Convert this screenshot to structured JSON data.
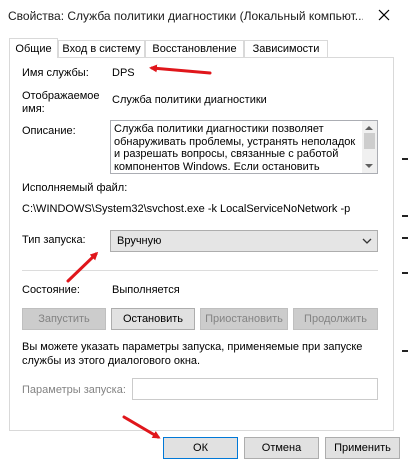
{
  "window": {
    "title": "Свойства: Служба политики диагностики (Локальный компьют..."
  },
  "tabs": [
    {
      "label": "Общие",
      "active": true
    },
    {
      "label": "Вход в систему",
      "active": false
    },
    {
      "label": "Восстановление",
      "active": false
    },
    {
      "label": "Зависимости",
      "active": false
    }
  ],
  "general": {
    "service_name_label": "Имя службы:",
    "service_name": "DPS",
    "display_name_label_line1": "Отображаемое",
    "display_name_label_line2": "имя:",
    "display_name": "Служба политики диагностики",
    "description_label": "Описание:",
    "description": "Служба политики диагностики позволяет обнаруживать проблемы, устранять неполадок и разрешать вопросы, связанные с работой компонентов Windows.  Если остановить",
    "executable_label": "Исполняемый файл:",
    "executable_path": "C:\\WINDOWS\\System32\\svchost.exe -k LocalServiceNoNetwork -p",
    "startup_type_label": "Тип запуска:",
    "startup_type": "Вручную",
    "status_label": "Состояние:",
    "status": "Выполняется",
    "hint": "Вы можете указать параметры запуска, применяемые при запуске службы из этого диалогового окна.",
    "start_params_label": "Параметры запуска:",
    "start_params_value": ""
  },
  "service_buttons": {
    "start": "Запустить",
    "stop": "Остановить",
    "pause": "Приостановить",
    "resume": "Продолжить"
  },
  "dialog_buttons": {
    "ok": "ОК",
    "cancel": "Отмена",
    "apply": "Применить"
  },
  "colors": {
    "annotation_arrow": "#e0161b",
    "focus_border": "#0078d7"
  }
}
